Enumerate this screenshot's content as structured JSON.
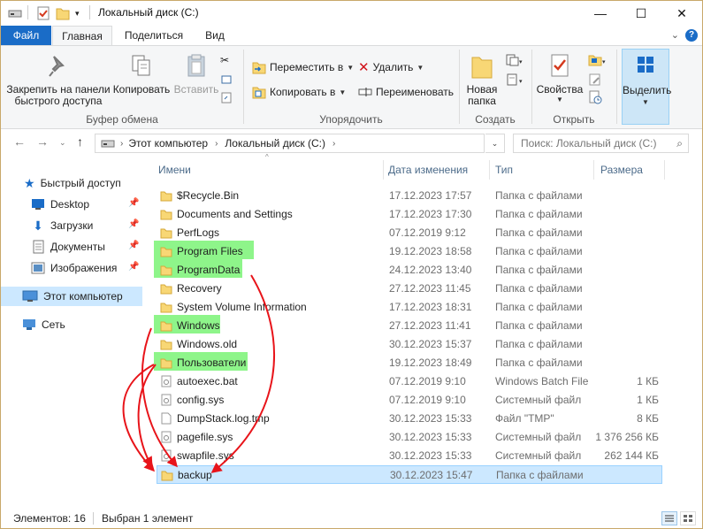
{
  "window": {
    "title": "Локальный диск (C:)",
    "controls": {
      "minimize": "—",
      "maximize": "☐",
      "close": "✕"
    }
  },
  "ribbon_tabs": [
    "Файл",
    "Главная",
    "Поделиться",
    "Вид"
  ],
  "ribbon": {
    "clipboard": {
      "group_label": "Буфер обмена",
      "pin_line1": "Закрепить на панели",
      "pin_line2": "быстрого доступа",
      "copy": "Копировать",
      "paste": "Вставить"
    },
    "organize": {
      "group_label": "Упорядочить",
      "move_to": "Переместить в",
      "copy_to": "Копировать в",
      "delete": "Удалить",
      "rename": "Переименовать"
    },
    "create": {
      "group_label": "Создать",
      "new_folder_line1": "Новая",
      "new_folder_line2": "папка"
    },
    "open": {
      "group_label": "Открыть",
      "properties": "Свойства"
    },
    "select": {
      "select": "Выделить"
    }
  },
  "address": {
    "crumbs": [
      "Этот компьютер",
      "Локальный диск (C:)"
    ],
    "search_placeholder": "Поиск: Локальный диск (C:)"
  },
  "nav": {
    "quick_access": "Быстрый доступ",
    "desktop": "Desktop",
    "downloads": "Загрузки",
    "documents": "Документы",
    "pictures": "Изображения",
    "this_pc": "Этот компьютер",
    "network": "Сеть"
  },
  "columns": {
    "name": "Имени",
    "date": "Дата изменения",
    "type": "Тип",
    "size": "Размера"
  },
  "files": [
    {
      "name": "$Recycle.Bin",
      "date": "17.12.2023 17:57",
      "type": "Папка с файлами",
      "size": "",
      "icon": "folder",
      "highlight": false
    },
    {
      "name": "Documents and Settings",
      "date": "17.12.2023 17:30",
      "type": "Папка с файлами",
      "size": "",
      "icon": "folder",
      "highlight": false
    },
    {
      "name": "PerfLogs",
      "date": "07.12.2019 9:12",
      "type": "Папка с файлами",
      "size": "",
      "icon": "folder",
      "highlight": false
    },
    {
      "name": "Program Files",
      "date": "19.12.2023 18:58",
      "type": "Папка с файлами",
      "size": "",
      "icon": "folder",
      "highlight": true
    },
    {
      "name": "ProgramData",
      "date": "24.12.2023 13:40",
      "type": "Папка с файлами",
      "size": "",
      "icon": "folder",
      "highlight": true
    },
    {
      "name": "Recovery",
      "date": "27.12.2023 11:45",
      "type": "Папка с файлами",
      "size": "",
      "icon": "folder",
      "highlight": false
    },
    {
      "name": "System Volume Information",
      "date": "17.12.2023 18:31",
      "type": "Папка с файлами",
      "size": "",
      "icon": "folder",
      "highlight": false
    },
    {
      "name": "Windows",
      "date": "27.12.2023 11:41",
      "type": "Папка с файлами",
      "size": "",
      "icon": "folder",
      "highlight": true
    },
    {
      "name": "Windows.old",
      "date": "30.12.2023 15:37",
      "type": "Папка с файлами",
      "size": "",
      "icon": "folder",
      "highlight": false
    },
    {
      "name": "Пользователи",
      "date": "19.12.2023 18:49",
      "type": "Папка с файлами",
      "size": "",
      "icon": "folder",
      "highlight": true
    },
    {
      "name": "autoexec.bat",
      "date": "07.12.2019 9:10",
      "type": "Windows Batch File",
      "size": "1 КБ",
      "icon": "gear-file",
      "highlight": false
    },
    {
      "name": "config.sys",
      "date": "07.12.2019 9:10",
      "type": "Системный файл",
      "size": "1 КБ",
      "icon": "gear-file",
      "highlight": false
    },
    {
      "name": "DumpStack.log.tmp",
      "date": "30.12.2023 15:33",
      "type": "Файл \"TMP\"",
      "size": "8 КБ",
      "icon": "file",
      "highlight": false
    },
    {
      "name": "pagefile.sys",
      "date": "30.12.2023 15:33",
      "type": "Системный файл",
      "size": "1 376 256 КБ",
      "icon": "gear-file",
      "highlight": false
    },
    {
      "name": "swapfile.sys",
      "date": "30.12.2023 15:33",
      "type": "Системный файл",
      "size": "262 144 КБ",
      "icon": "gear-file",
      "highlight": false
    },
    {
      "name": "backup",
      "date": "30.12.2023 15:47",
      "type": "Папка с файлами",
      "size": "",
      "icon": "folder",
      "highlight": false,
      "selected": true
    }
  ],
  "status": {
    "count": "Элементов: 16",
    "selected": "Выбран 1 элемент"
  },
  "colors": {
    "accent": "#1a6cc7",
    "highlight": "#8ef58a",
    "selection": "#cce8ff",
    "arrow": "#e8141a",
    "folder": "#f8d775"
  }
}
